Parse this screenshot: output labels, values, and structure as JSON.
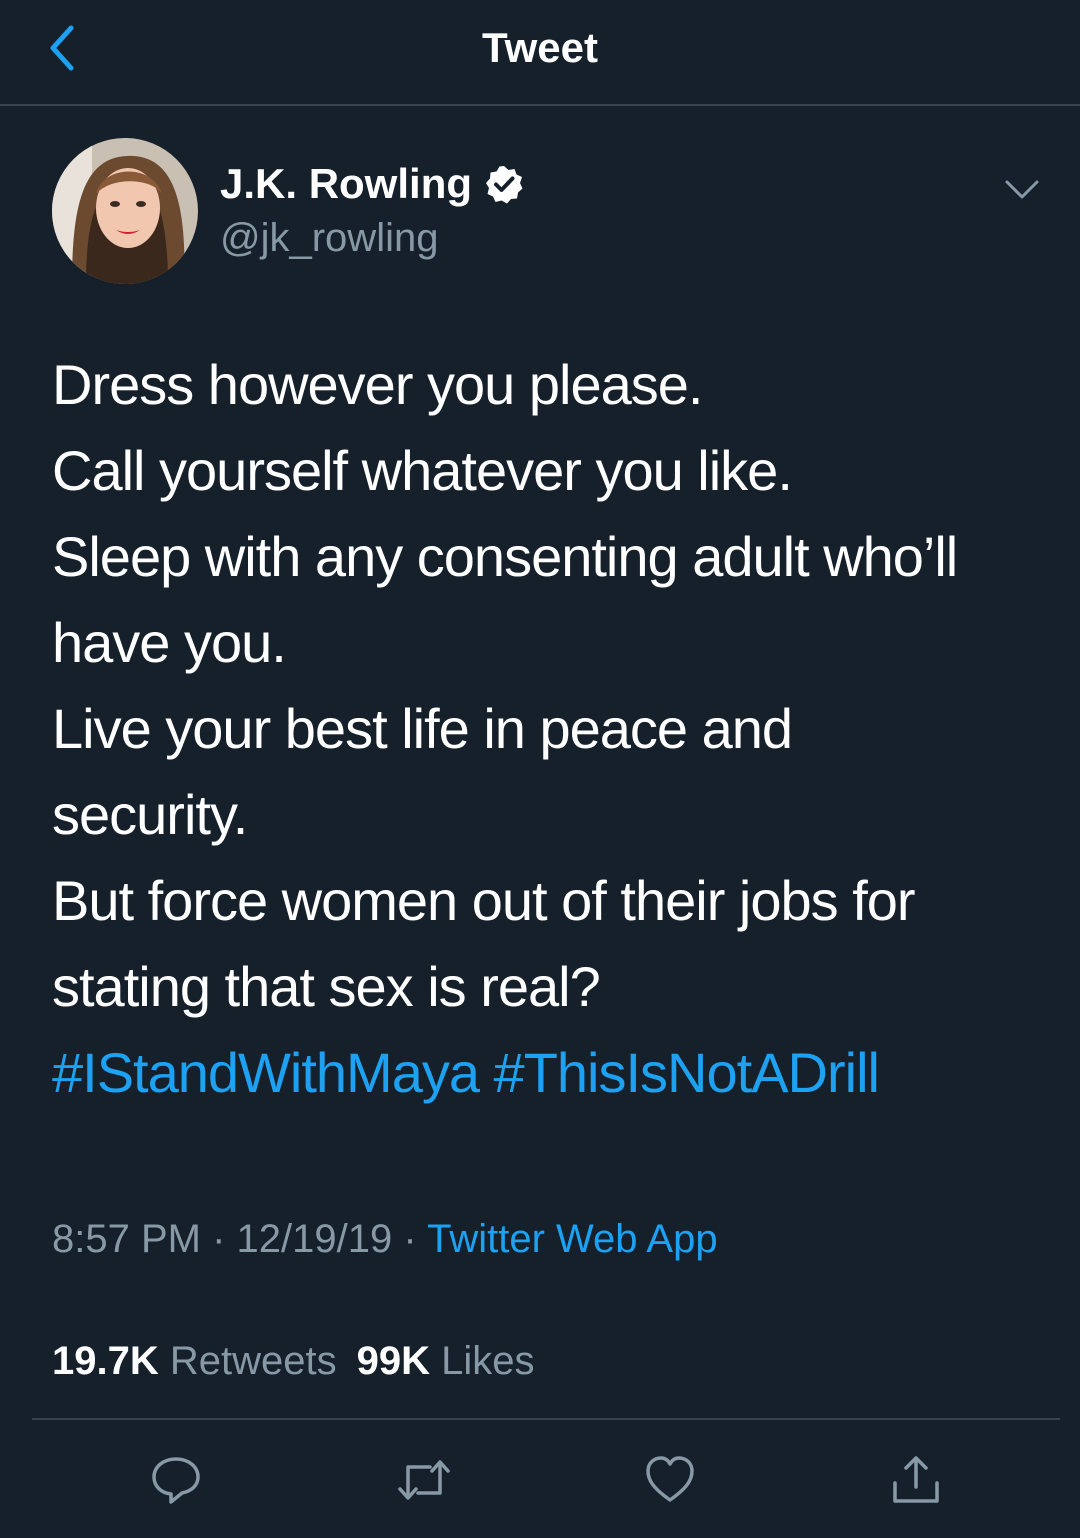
{
  "header": {
    "title": "Tweet",
    "back_icon": "chevron-left-icon"
  },
  "author": {
    "display_name": "J.K. Rowling",
    "handle": "@jk_rowling",
    "verified": true
  },
  "tweet": {
    "lines": [
      "Dress however you please.",
      "Call yourself whatever you like.",
      "Sleep with any consenting adult who’ll",
      "have you.",
      "Live your best life in peace and",
      "security.",
      "But force women out of their jobs for",
      "stating that sex is real?"
    ],
    "hashtags": [
      "#IStandWithMaya",
      "#ThisIsNotADrill"
    ]
  },
  "meta": {
    "time": "8:57 PM",
    "separator": "·",
    "date": "12/19/19",
    "source": "Twitter Web App"
  },
  "stats": {
    "retweets_count": "19.7K",
    "retweets_label": "Retweets",
    "likes_count": "99K",
    "likes_label": "Likes"
  },
  "actions": [
    "reply-icon",
    "retweet-icon",
    "like-icon",
    "share-icon"
  ],
  "colors": {
    "background": "#15202b",
    "accent": "#1da1f2",
    "secondary_text": "#8899a6",
    "divider": "#38444d"
  }
}
